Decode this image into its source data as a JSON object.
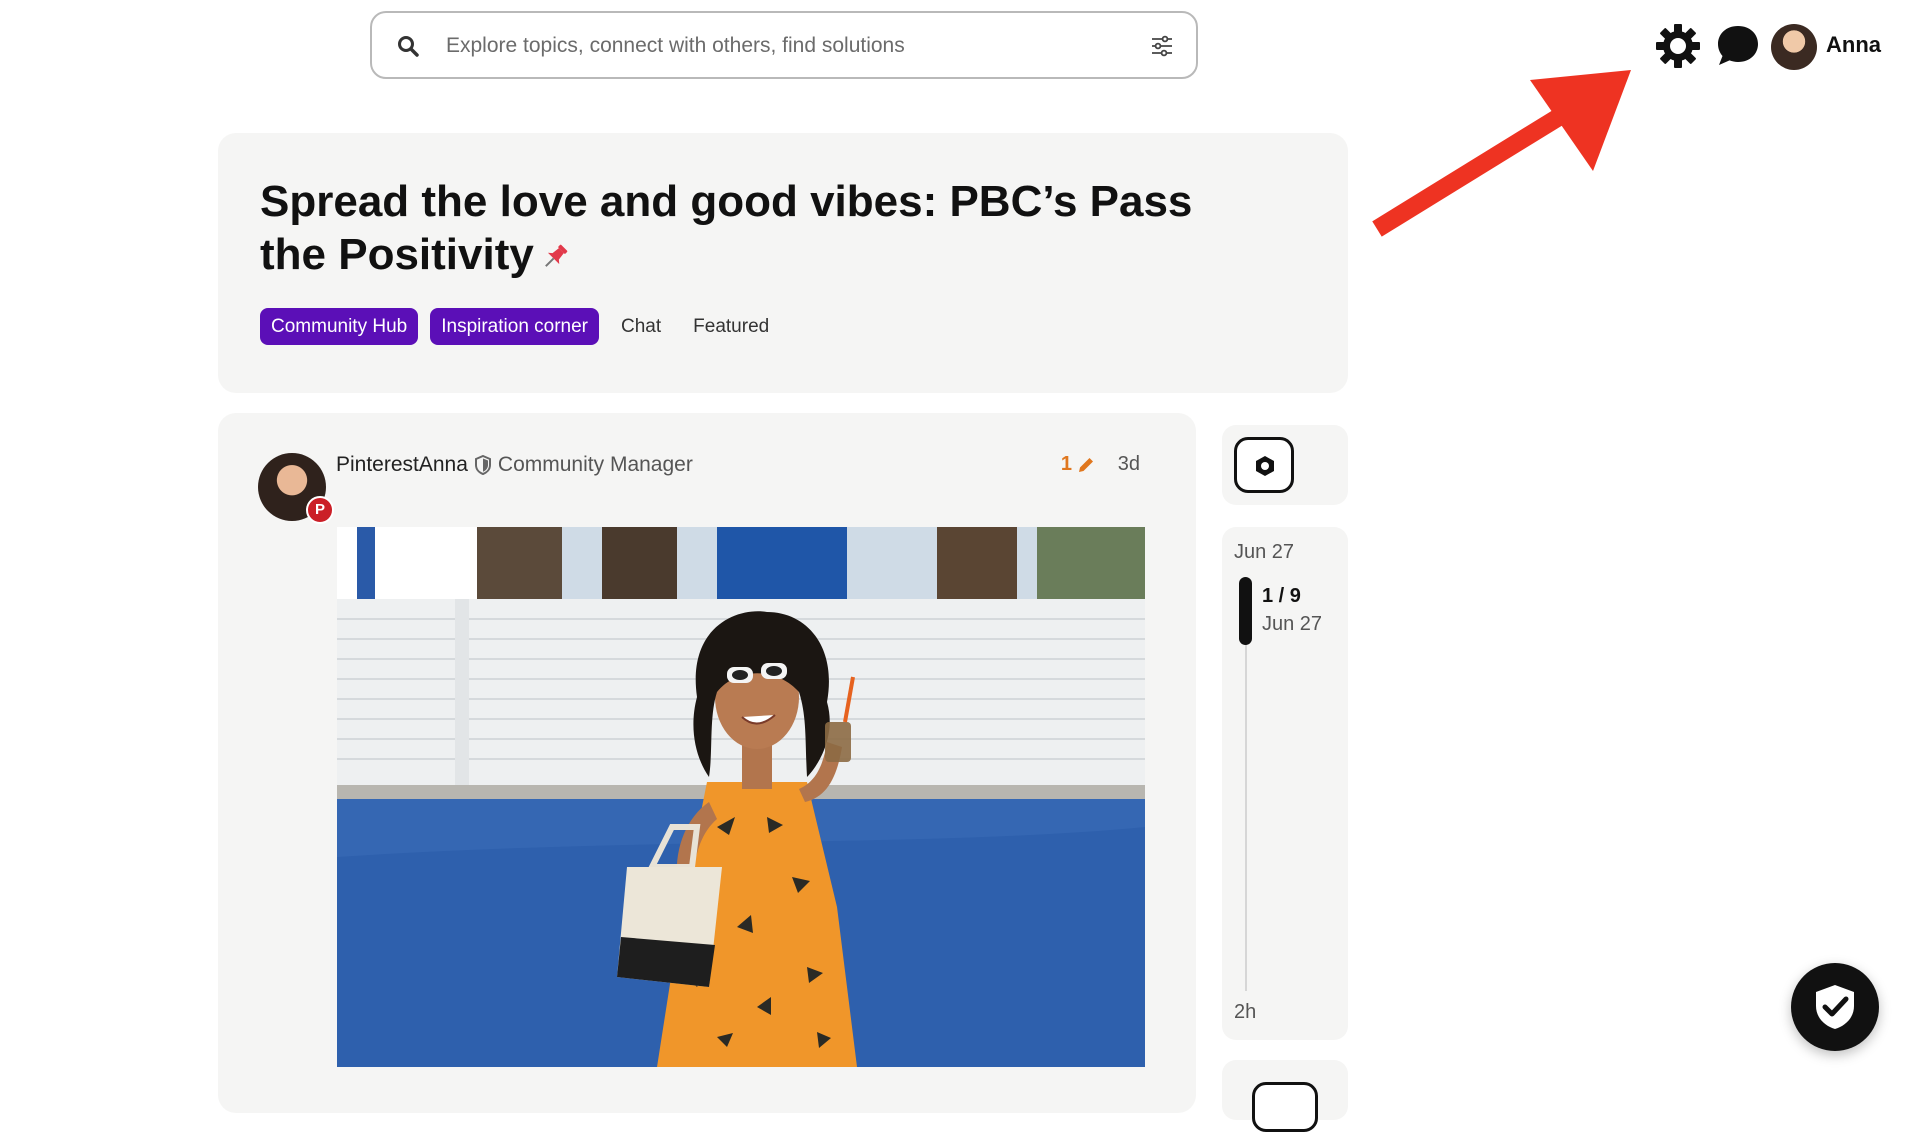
{
  "search": {
    "placeholder": "Explore topics, connect with others, find solutions"
  },
  "header": {
    "user_name": "Anna",
    "icons": [
      "gear-icon",
      "chat-icon",
      "avatar"
    ]
  },
  "topic": {
    "title": "Spread the love and good vibes: PBC’s Pass the Positivity",
    "pinned": true,
    "tags": [
      {
        "label": "Community Hub",
        "style": "badge"
      },
      {
        "label": "Inspiration corner",
        "style": "badge"
      },
      {
        "label": "Chat",
        "style": "plain"
      },
      {
        "label": "Featured",
        "style": "plain"
      }
    ]
  },
  "post": {
    "author": "PinterestAnna",
    "author_title": "Community Manager",
    "edit_count": "1",
    "age": "3d",
    "avatar_badge": "P"
  },
  "timeline": {
    "start_date": "Jun 27",
    "position": "1 / 9",
    "current_date": "Jun 27",
    "end_label": "2h"
  },
  "colors": {
    "tag_badge": "#5b0fb7",
    "edit_orange": "#e0771e",
    "arrow_red": "#ee3322",
    "card_bg": "#f5f5f4"
  }
}
